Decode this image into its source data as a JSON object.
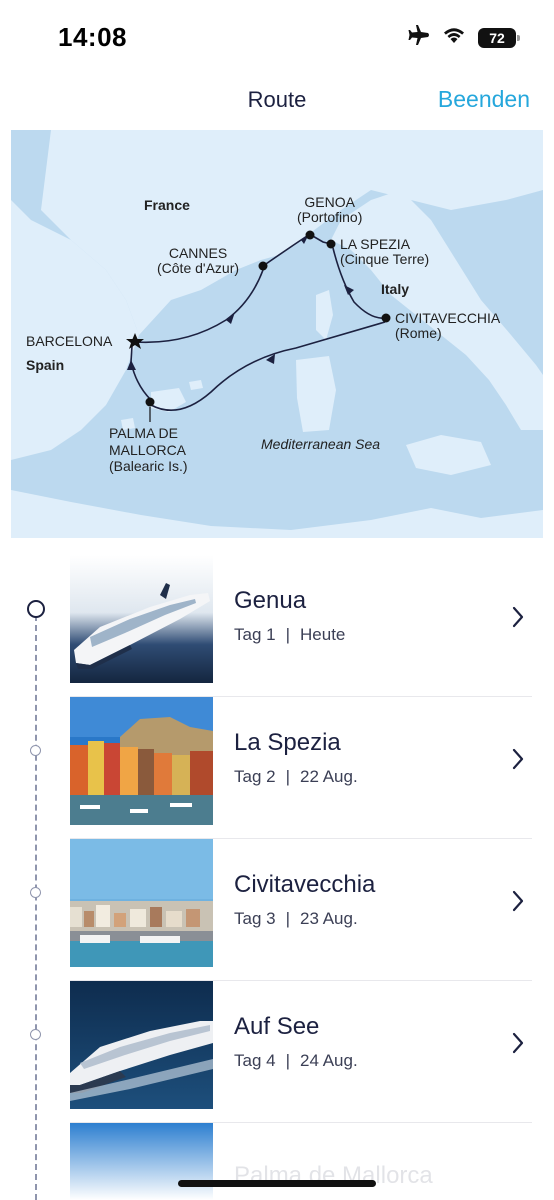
{
  "status_bar": {
    "time": "14:08",
    "battery": "72",
    "icons": [
      "airplane-icon",
      "wifi-icon",
      "battery-icon"
    ]
  },
  "nav": {
    "title": "Route",
    "done_label": "Beenden"
  },
  "map": {
    "countries": {
      "france": "France",
      "spain": "Spain",
      "italy": "Italy"
    },
    "sea": "Mediterranean Sea",
    "ports": {
      "genoa": {
        "name": "GENOA",
        "sub": "(Portofino)"
      },
      "cannes": {
        "name": "CANNES",
        "sub": "(Côte d'Azur)"
      },
      "la_spezia": {
        "name": "LA SPEZIA",
        "sub": "(Cinque Terre)"
      },
      "civitavecchia": {
        "name": "CIVITAVECCHIA",
        "sub": "(Rome)"
      },
      "barcelona": {
        "name": "BARCELONA"
      },
      "palma": {
        "line1": "PALMA DE",
        "line2": "MALLORCA",
        "sub": "(Balearic Is.)"
      }
    },
    "colors": {
      "sea": "#bcd9ef",
      "land": "#dfeefa",
      "route": "#1c2140"
    }
  },
  "stops": [
    {
      "name": "Genua",
      "day": "Tag 1",
      "date": "Heute"
    },
    {
      "name": "La Spezia",
      "day": "Tag 2",
      "date": "22 Aug."
    },
    {
      "name": "Civitavecchia",
      "day": "Tag 3",
      "date": "23 Aug."
    },
    {
      "name": "Auf See",
      "day": "Tag 4",
      "date": "24 Aug."
    }
  ],
  "partial_stop": {
    "name": "Palma de Mallorca"
  },
  "colors": {
    "accent": "#25a7dc",
    "navy": "#1c2140"
  }
}
